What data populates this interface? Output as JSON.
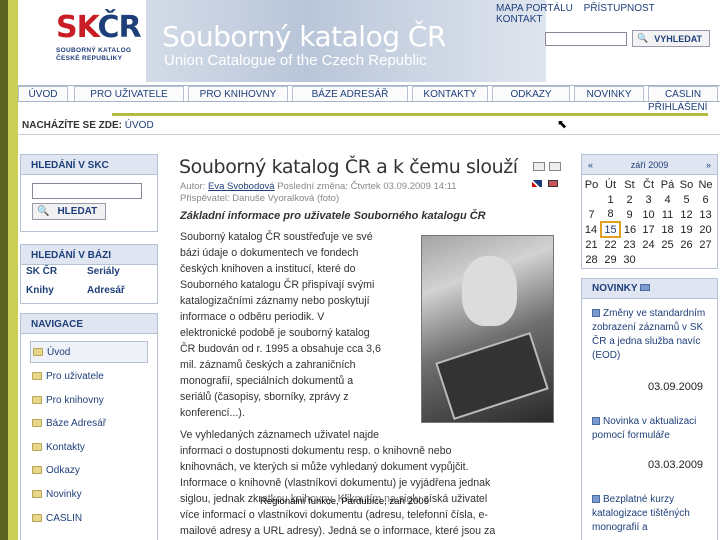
{
  "header": {
    "logo_mark_a": "SK",
    "logo_mark_b": "ČR",
    "logo_sub_1": "SOUBORNÝ KATALOG",
    "logo_sub_2": "ČESKÉ REPUBLIKY",
    "title": "Souborný katalog ČR",
    "subtitle": "Union Catalogue of the Czech Republic",
    "toplinks": [
      "MAPA PORTÁLU",
      "PŘÍSTUPNOST",
      "KONTAKT"
    ],
    "search_value": "",
    "search_button": "VYHLEDAT"
  },
  "nav": {
    "tabs": [
      "ÚVOD",
      "PRO UŽIVATELE",
      "PRO KNIHOVNY",
      "BÁZE ADRESÁŘ",
      "KONTAKTY",
      "ODKAZY",
      "NOVINKY",
      "CASLIN"
    ],
    "login": "PŘIHLÁŠENÍ"
  },
  "breadcrumb": {
    "label": "NACHÁZÍTE SE ZDE:",
    "current": "ÚVOD"
  },
  "left": {
    "search_box": {
      "title": "HLEDÁNÍ V SKC",
      "button": "HLEDAT",
      "value": ""
    },
    "bazi_box": {
      "title": "HLEDÁNÍ V BÁZI",
      "items": [
        "SK ČR",
        "Seriály",
        "Knihy",
        "Adresář"
      ]
    },
    "nav_box": {
      "title": "NAVIGACE",
      "items": [
        "Úvod",
        "Pro uživatele",
        "Pro knihovny",
        "Báze Adresář",
        "Kontakty",
        "Odkazy",
        "Novinky",
        "CASLIN"
      ]
    }
  },
  "article": {
    "title": "Souborný katalog ČR a k čemu slouží",
    "meta_author_label": "Autor:",
    "meta_author": "Eva Svobodová",
    "meta_change": "Poslední změna: Čtvrtek 03.09.2009 14:11",
    "meta_contrib": "Přispěvatel: Danuše Vyoralková (foto)",
    "subhead": "Základní informace pro uživatele Souborného katalogu ČR",
    "para1_lines": [
      "Souborný katalog ČR soustřeďuje ve své",
      "bázi údaje o dokumentech ve fondech",
      "českých knihoven a institucí, které do",
      "Souborného katalogu ČR přispívají svými",
      "katalogizačními záznamy nebo poskytují",
      "informace o odběru periodik. V",
      "elektronické podobě je souborný katalog",
      "ČR budován od r. 1995 a obsahuje cca 3,6",
      "mil. záznamů českých a zahraničních",
      "monografií, speciálních dokumentů a",
      "seriálů (časopisy, sborníky, zprávy z",
      "konferencí...)."
    ],
    "para2_lines": [
      "Ve vyhledaných záznamech uživatel najde",
      "informaci o dostupnosti dokumentu resp. o knihovně nebo",
      "knihovnách, ve kterých si může vyhledaný dokument vypůjčit.",
      "Informace o knihovně (vlastníkovi dokumentu) je vyjádřena jednak",
      "siglou, jednak zkratkou knihovny. Kliknutím na siglu získá uživatel",
      "více informací o vlastníkovi dokumentu (adresu, telefonní čísla, e-",
      "mailové adresy a URL adresy). Jedná se o informace, které jsou za"
    ],
    "footer_note": "Regionální funkce, Pardubice, září 2009"
  },
  "calendar": {
    "month": "září 2009",
    "prev": "«",
    "next": "»",
    "dow": [
      "Po",
      "Út",
      "St",
      "Čt",
      "Pá",
      "So",
      "Ne"
    ],
    "rows": [
      [
        "",
        "1",
        "2",
        "3",
        "4",
        "5",
        "6"
      ],
      [
        "7",
        "8",
        "9",
        "10",
        "11",
        "12",
        "13"
      ],
      [
        "14",
        "15",
        "16",
        "17",
        "18",
        "19",
        "20"
      ],
      [
        "21",
        "22",
        "23",
        "24",
        "25",
        "26",
        "27"
      ],
      [
        "28",
        "29",
        "30",
        "",
        "",
        "",
        ""
      ]
    ],
    "today": "15"
  },
  "news": {
    "title": "NOVINKY",
    "items": [
      {
        "text": "Změny ve standardním zobrazení záznamů v SK ČR a jedna služba navíc (EOD)",
        "date": "03.09.2009"
      },
      {
        "text": "Novinka v aktualizaci pomocí formuláře",
        "date": "03.03.2009"
      },
      {
        "text": "Bezplatné kurzy katalogizace tištěných monografií a",
        "date": ""
      }
    ]
  },
  "colors": {
    "brand_blue": "#1f3f7a",
    "brand_red": "#c81d25",
    "accent_olive": "#b4bb3e"
  }
}
